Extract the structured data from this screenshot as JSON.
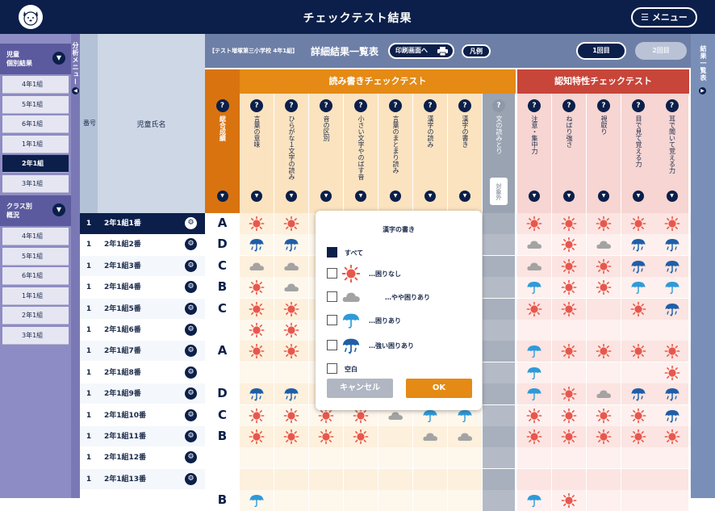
{
  "header": {
    "title": "チェックテスト結果",
    "menu_label": "☰ メニュー"
  },
  "left_panel": {
    "tab_label": "分析メニュー",
    "section1": {
      "label_l1": "児童",
      "label_l2": "個別結果"
    },
    "section1_items": [
      "4年1組",
      "5年1組",
      "6年1組",
      "1年1組",
      "2年1組",
      "3年1組"
    ],
    "selected_index": 4,
    "section2": {
      "label_l1": "クラス別",
      "label_l2": "概況"
    },
    "section2_items": [
      "4年1組",
      "5年1組",
      "6年1組",
      "1年1組",
      "2年1組",
      "3年1組"
    ]
  },
  "right_panel": {
    "tab_label": "結果一覧表"
  },
  "toolbar": {
    "org": "【テスト増塚第三小学校 4年1組】",
    "title": "詳細結果一覧表",
    "print_label": "印刷画面へ",
    "legend_label": "凡例",
    "round1": "1回目",
    "round2": "2回目"
  },
  "table_header": {
    "num": "番号",
    "name": "児童氏名",
    "score_label": "総合成績"
  },
  "groups": {
    "read_write": "読み書きチェックテスト",
    "cognitive": "認知特性チェックテスト"
  },
  "columns_rw": [
    "言葉の意味",
    "ひらがな１文字の読み",
    "音の区別",
    "小さい文字やのばす音",
    "言葉のまとまり読み",
    "漢字の読み",
    "漢字の書き",
    "文の読みとり"
  ],
  "excluded_tag": "対象外",
  "columns_cog": [
    "注意・集中力",
    "ねばり強さ",
    "視取り",
    "目で見て覚える力",
    "耳で聞いて覚える力"
  ],
  "colors": {
    "navy": "#0b1f4a",
    "orange": "#e58a14",
    "red": "#c8453a",
    "sun": "#e8574c",
    "umbrella_light": "#2f9ad8",
    "umbrella_dark": "#1f5ea8",
    "cloud": "#a3a3a3"
  },
  "students": [
    {
      "no": "1",
      "name": "2年1組1番",
      "grade": "A",
      "rw": [
        "sun",
        "sun",
        "",
        "",
        "",
        "",
        "",
        "blank"
      ],
      "cog": [
        "sun",
        "sun",
        "sun",
        "sun",
        "sun"
      ]
    },
    {
      "no": "1",
      "name": "2年1組2番",
      "grade": "D",
      "rw": [
        "rain",
        "rain",
        "",
        "",
        "",
        "",
        "",
        "blank"
      ],
      "cog": [
        "cloud",
        "sun",
        "cloud",
        "rain",
        "rain"
      ]
    },
    {
      "no": "1",
      "name": "2年1組3番",
      "grade": "C",
      "rw": [
        "cloud",
        "cloud",
        "",
        "",
        "",
        "",
        "",
        "blank"
      ],
      "cog": [
        "cloud",
        "sun",
        "sun",
        "rain",
        "rain"
      ]
    },
    {
      "no": "1",
      "name": "2年1組4番",
      "grade": "B",
      "rw": [
        "sun",
        "cloud",
        "",
        "",
        "",
        "",
        "",
        "blank"
      ],
      "cog": [
        "umbrella",
        "sun",
        "sun",
        "umbrella",
        "umbrella"
      ]
    },
    {
      "no": "1",
      "name": "2年1組5番",
      "grade": "C",
      "rw": [
        "sun",
        "sun",
        "",
        "",
        "",
        "",
        "",
        "blank"
      ],
      "cog": [
        "sun",
        "sun",
        "",
        "sun",
        "rain"
      ]
    },
    {
      "no": "1",
      "name": "2年1組6番",
      "grade": "",
      "rw": [
        "sun",
        "sun",
        "",
        "",
        "",
        "",
        "",
        "blank"
      ],
      "cog": [
        "",
        "",
        "",
        "",
        ""
      ]
    },
    {
      "no": "1",
      "name": "2年1組7番",
      "grade": "A",
      "rw": [
        "sun",
        "sun",
        "",
        "",
        "",
        "",
        "",
        "blank"
      ],
      "cog": [
        "umbrella",
        "sun",
        "sun",
        "sun",
        "sun"
      ]
    },
    {
      "no": "1",
      "name": "2年1組8番",
      "grade": "",
      "rw": [
        "",
        "",
        "",
        "",
        "",
        "",
        "",
        "blank"
      ],
      "cog": [
        "umbrella",
        "",
        "",
        "",
        "sun"
      ]
    },
    {
      "no": "1",
      "name": "2年1組9番",
      "grade": "D",
      "rw": [
        "rain",
        "rain",
        "",
        "",
        "",
        "",
        "",
        "blank"
      ],
      "cog": [
        "umbrella",
        "sun",
        "cloud",
        "rain",
        "rain"
      ]
    },
    {
      "no": "1",
      "name": "2年1組10番",
      "grade": "C",
      "rw": [
        "sun",
        "sun",
        "sun",
        "sun",
        "cloud",
        "umbrella",
        "umbrella",
        "blank"
      ],
      "cog": [
        "sun",
        "sun",
        "sun",
        "sun",
        "rain"
      ]
    },
    {
      "no": "1",
      "name": "2年1組11番",
      "grade": "B",
      "rw": [
        "sun",
        "sun",
        "sun",
        "sun",
        "",
        "cloud",
        "cloud",
        "blank"
      ],
      "cog": [
        "sun",
        "sun",
        "sun",
        "sun",
        "sun"
      ]
    },
    {
      "no": "1",
      "name": "2年1組12番",
      "grade": "",
      "rw": [
        "",
        "",
        "",
        "",
        "",
        "",
        "",
        "blank"
      ],
      "cog": [
        "",
        "",
        "",
        "",
        ""
      ]
    },
    {
      "no": "1",
      "name": "2年1組13番",
      "grade": "",
      "rw": [
        "",
        "",
        "",
        "",
        "",
        "",
        "",
        "blank"
      ],
      "cog": [
        "",
        "",
        "",
        "",
        ""
      ]
    },
    {
      "no": "",
      "name": "",
      "grade": "B",
      "rw": [
        "umbrella",
        "",
        "",
        "",
        "",
        "",
        "",
        "blank"
      ],
      "cog": [
        "umbrella",
        "sun",
        "",
        "",
        ""
      ]
    }
  ],
  "modal": {
    "title": "漢字の書き",
    "options": [
      {
        "label": "すべて",
        "checked": true,
        "icon": ""
      },
      {
        "label": "…困りなし",
        "checked": false,
        "icon": "sun"
      },
      {
        "label": "…やや困りあり",
        "checked": false,
        "icon": "cloud"
      },
      {
        "label": "…困りあり",
        "checked": false,
        "icon": "umbrella"
      },
      {
        "label": "…強い困りあり",
        "checked": false,
        "icon": "rain"
      },
      {
        "label": "空白",
        "checked": false,
        "icon": ""
      }
    ],
    "cancel_label": "キャンセル",
    "ok_label": "OK"
  }
}
